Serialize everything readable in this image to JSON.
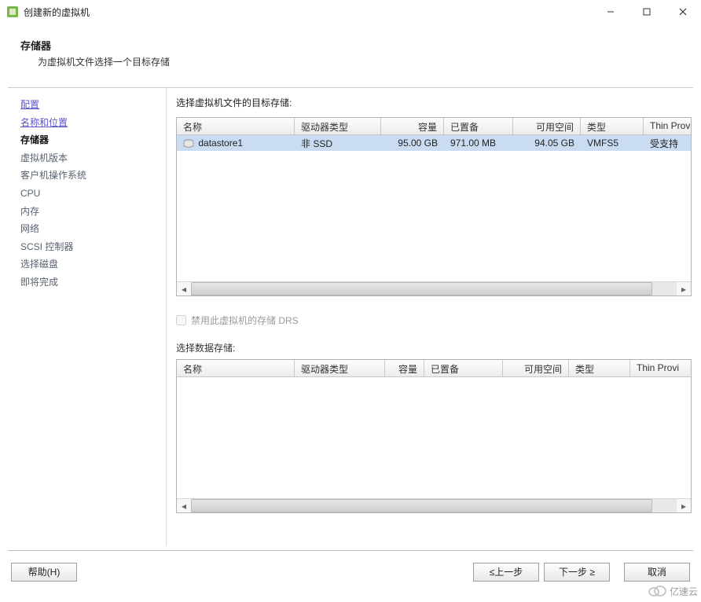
{
  "window": {
    "title": "创建新的虚拟机"
  },
  "header": {
    "title": "存储器",
    "subtitle": "为虚拟机文件选择一个目标存储"
  },
  "sidebar": {
    "items": [
      {
        "label": "配置",
        "kind": "link"
      },
      {
        "label": "名称和位置",
        "kind": "link"
      },
      {
        "label": "存储器",
        "kind": "current"
      },
      {
        "label": "虚拟机版本",
        "kind": "normal"
      },
      {
        "label": "客户机操作系统",
        "kind": "normal"
      },
      {
        "label": "CPU",
        "kind": "normal"
      },
      {
        "label": "内存",
        "kind": "normal"
      },
      {
        "label": "网络",
        "kind": "normal"
      },
      {
        "label": "SCSI 控制器",
        "kind": "normal"
      },
      {
        "label": "选择磁盘",
        "kind": "normal"
      },
      {
        "label": "即将完成",
        "kind": "normal"
      }
    ]
  },
  "main": {
    "prompt": "选择虚拟机文件的目标存储:",
    "columns": {
      "name": "名称",
      "drive_type": "驱动器类型",
      "capacity": "容量",
      "provisioned": "已置备",
      "free": "可用空间",
      "type": "类型",
      "thin": "Thin Prov"
    },
    "rows": [
      {
        "name": "datastore1",
        "drive_type": "非 SSD",
        "capacity": "95.00 GB",
        "provisioned": "971.00 MB",
        "free": "94.05 GB",
        "type": "VMFS5",
        "thin": "受支持"
      }
    ],
    "drs_checkbox_label": "禁用此虚拟机的存储 DRS",
    "datastore_label": "选择数据存储:",
    "columns2": {
      "name": "名称",
      "drive_type": "驱动器类型",
      "capacity": "容量",
      "provisioned": "已置备",
      "free": "可用空间",
      "type": "类型",
      "thin": "Thin Provi"
    }
  },
  "footer": {
    "help": "帮助(H)",
    "back": "≤上一步",
    "next": "下一步 ≥",
    "cancel": "取消"
  },
  "watermark": "亿速云"
}
